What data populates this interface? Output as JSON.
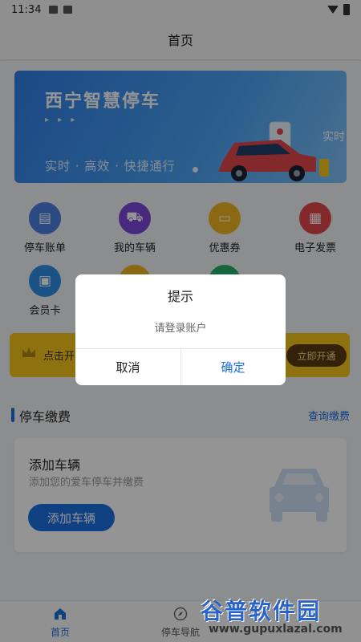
{
  "status_bar": {
    "time": "11:34"
  },
  "header": {
    "title": "首页"
  },
  "banner": {
    "title": "西宁智慧停车",
    "arrows": "▸ ▸ ▸",
    "slogan": "实时 · 高效 · 快捷通行",
    "side_text": "实时"
  },
  "grid": [
    {
      "label": "停车账单",
      "icon": "bill-icon",
      "color": "#4a7fe0",
      "glyph": "▤"
    },
    {
      "label": "我的车辆",
      "icon": "car-icon",
      "color": "#7a48d8",
      "glyph": "⛟"
    },
    {
      "label": "优惠券",
      "icon": "coupon-icon",
      "color": "#f0b323",
      "glyph": "▭"
    },
    {
      "label": "电子发票",
      "icon": "invoice-icon",
      "color": "#e2474b",
      "glyph": "▦"
    },
    {
      "label": "会员卡",
      "icon": "member-card-icon",
      "color": "#2f8ee6",
      "glyph": "▣"
    }
  ],
  "member_strip": {
    "text": "点击开",
    "button": "立即开通"
  },
  "section": {
    "title": "停车缴费",
    "link": "查询缴费"
  },
  "vehicle_card": {
    "title": "添加车辆",
    "subtitle": "添加您的爱车停车并缴费",
    "button": "添加车辆"
  },
  "bottom_nav": [
    {
      "label": "首页",
      "icon": "home-icon",
      "active": true
    },
    {
      "label": "停车导航",
      "icon": "compass-icon",
      "active": false
    }
  ],
  "watermark": {
    "text": "谷普软件园",
    "url": "www.gupuxlazal.com"
  },
  "dialog": {
    "title": "提示",
    "message": "请登录账户",
    "cancel": "取消",
    "confirm": "确定"
  },
  "colors": {
    "accent": "#1a6fe0",
    "member": "#f4c51c"
  }
}
